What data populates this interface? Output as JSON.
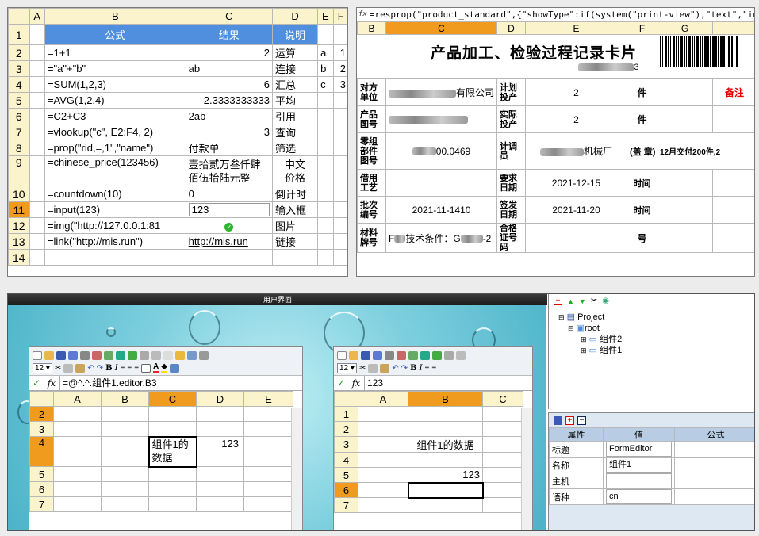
{
  "sheet1": {
    "cols": [
      "",
      "A",
      "B",
      "C",
      "D",
      "E",
      "F"
    ],
    "header": {
      "b": "公式",
      "c": "结果",
      "d": "说明"
    },
    "rows": [
      {
        "n": "1"
      },
      {
        "n": "2",
        "b": "=1+1",
        "c": "2",
        "d": "运算",
        "e": "a",
        "f": "1"
      },
      {
        "n": "3",
        "b": "=\"a\"+\"b\"",
        "c": "ab",
        "d": "连接",
        "e": "b",
        "f": "2"
      },
      {
        "n": "4",
        "b": "=SUM(1,2,3)",
        "c": "6",
        "d": "汇总",
        "e": "c",
        "f": "3"
      },
      {
        "n": "5",
        "b": "=AVG(1,2,4)",
        "c": "2.3333333333",
        "d": "平均"
      },
      {
        "n": "6",
        "b": "=C2+C3",
        "c": "2ab",
        "d": "引用"
      },
      {
        "n": "7",
        "b": "=vlookup(\"c\", E2:F4, 2)",
        "c": "3",
        "d": "查询"
      },
      {
        "n": "8",
        "b": "=prop(\"rid,=,1\",\"name\")",
        "c": "付款单",
        "d": "筛选"
      },
      {
        "n": "9",
        "b": "=chinese_price(123456)",
        "c1": "壹拾贰万叁仟肆",
        "c2": "佰伍拾陆元整",
        "d1": "中文",
        "d2": "价格"
      },
      {
        "n": "10",
        "b": "=countdown(10)",
        "c": "0",
        "d": "倒计时"
      },
      {
        "n": "11",
        "b": "=input(123)",
        "c": "123",
        "d": "输入框"
      },
      {
        "n": "12",
        "b": "=img(\"http://127.0.0.1:81",
        "d": "图片"
      },
      {
        "n": "13",
        "b": "=link(\"http://mis.run\")",
        "c": "http://mis.run",
        "d": "链接"
      },
      {
        "n": "14"
      }
    ]
  },
  "card": {
    "formula": "=resprop(\"product_standard\",{\"showType\":if(system(\"print-view\"),\"text\",\"input\")})",
    "cols": [
      "B",
      "C",
      "D",
      "E",
      "F",
      "G"
    ],
    "title": "产品加工、检验过程记录卡片",
    "code_suffix": "3",
    "r1": {
      "l1": "对方单位",
      "v1_suffix": "有限公司",
      "l2": "计划投产",
      "v2": "2",
      "unit": "件",
      "note": "备注"
    },
    "r2": {
      "l1": "产品图号",
      "l2": "实际投产",
      "v2": "2",
      "unit": "件"
    },
    "r3": {
      "l1": "零组部件图号",
      "v1_suffix": "00.0469",
      "l2": "计调员",
      "v2_suffix": "机械厂",
      "seal": "(盖 章)",
      "remark": "12月交付200件,2"
    },
    "r4": {
      "l1": "借用工艺",
      "l2": "要求日期",
      "v2": "2021-12-15",
      "unit": "时间"
    },
    "r5": {
      "l1": "批次编号",
      "v1": "2021-11-1410",
      "l2": "签发日期",
      "v2": "2021-11-20",
      "unit": "时间"
    },
    "r6": {
      "l1": "材料牌号",
      "v1_pre": "F",
      "v1_mid": "技术条件：G",
      "v1_suf": "-2",
      "l2": "合格证号码",
      "unit": "号"
    }
  },
  "ui": {
    "title": "用户界面",
    "ed1": {
      "font_size": "12",
      "formula": "=@^.^.组件1.editor.B3",
      "cols": [
        "A",
        "B",
        "C",
        "D",
        "E"
      ],
      "rows": [
        "2",
        "3",
        "4",
        "5",
        "6",
        "7"
      ],
      "c4_1": "组件1的",
      "c4_2": "数据",
      "d4": "123"
    },
    "ed2": {
      "font_size": "12",
      "formula": "123",
      "cols": [
        "A",
        "B",
        "C"
      ],
      "rows": [
        "1",
        "2",
        "3",
        "4",
        "5",
        "6",
        "7"
      ],
      "b3": "组件1的数据",
      "b5": "123"
    },
    "tree": {
      "project": "Project",
      "root": "root",
      "c2": "组件2",
      "c1": "组件1"
    },
    "props": {
      "headers": [
        "属性",
        "值",
        "公式"
      ],
      "rows": [
        {
          "k": "标题",
          "v": "FormEditor"
        },
        {
          "k": "名称",
          "v": "组件1"
        },
        {
          "k": "主机",
          "v": ""
        },
        {
          "k": "语种",
          "v": "cn"
        }
      ]
    },
    "accent": "#f09a1e"
  }
}
